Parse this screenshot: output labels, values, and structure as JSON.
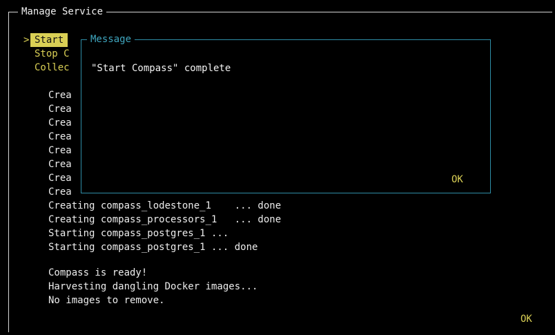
{
  "window": {
    "title": "Manage Service",
    "ok_label": "OK"
  },
  "menu": {
    "marker": ">",
    "items": [
      {
        "label": "Start",
        "selected": true
      },
      {
        "label": "Stop C",
        "selected": false
      },
      {
        "label": "Collec",
        "selected": false
      }
    ]
  },
  "log": {
    "obscured_lines": [
      "Crea",
      "Crea",
      "Crea",
      "Crea",
      "Crea",
      "Crea",
      "Crea",
      "Crea"
    ],
    "lines": [
      "Creating compass_lodestone_1    ... done",
      "Creating compass_processors_1   ... done",
      "Starting compass_postgres_1 ...",
      "Starting compass_postgres_1 ... done"
    ],
    "status_lines": [
      "Compass is ready!",
      "Harvesting dangling Docker images...",
      "No images to remove."
    ]
  },
  "dialog": {
    "title": "Message",
    "message": "\"Start Compass\" complete",
    "ok_label": "OK"
  },
  "colors": {
    "background": "#000000",
    "selection": "#d9cf55",
    "dialog_border": "#2f8fa8",
    "text": "#ededed"
  }
}
